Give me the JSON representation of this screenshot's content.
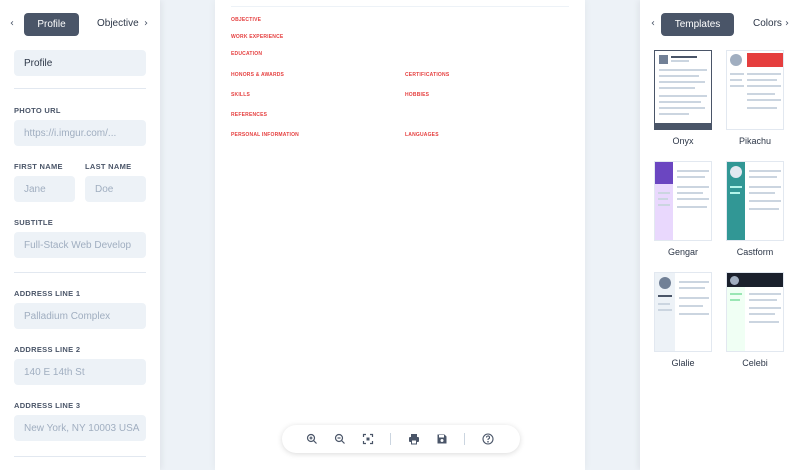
{
  "left_panel": {
    "tabs": {
      "active": "Profile",
      "next": "Objective"
    },
    "section_heading_value": "Profile",
    "fields": {
      "photo_url": {
        "label": "PHOTO URL",
        "placeholder": "https://i.imgur.com/..."
      },
      "first_name": {
        "label": "FIRST NAME",
        "placeholder": "Jane"
      },
      "last_name": {
        "label": "LAST NAME",
        "placeholder": "Doe"
      },
      "subtitle": {
        "label": "SUBTITLE",
        "placeholder": "Full-Stack Web Develop"
      },
      "address_line_1": {
        "label": "ADDRESS LINE 1",
        "placeholder": "Palladium Complex"
      },
      "address_line_2": {
        "label": "ADDRESS LINE 2",
        "placeholder": "140 E 14th St"
      },
      "address_line_3": {
        "label": "ADDRESS LINE 3",
        "placeholder": "New York, NY 10003 USA"
      }
    }
  },
  "page": {
    "sections_left": [
      "OBJECTIVE",
      "WORK EXPERIENCE",
      "EDUCATION",
      "HONORS & AWARDS",
      "SKILLS",
      "REFERENCES",
      "PERSONAL INFORMATION"
    ],
    "sections_right": [
      "CERTIFICATIONS",
      "HOBBIES",
      "LANGUAGES"
    ],
    "accent_color": "#e53e3e"
  },
  "toolbar": {
    "icons": [
      "zoom-in-icon",
      "zoom-out-icon",
      "fit-screen-icon",
      "print-icon",
      "save-icon",
      "help-icon"
    ]
  },
  "right_panel": {
    "tabs": {
      "active": "Templates",
      "next": "Colors"
    },
    "templates": [
      "Onyx",
      "Pikachu",
      "Gengar",
      "Castform",
      "Glalie",
      "Celebi"
    ]
  }
}
